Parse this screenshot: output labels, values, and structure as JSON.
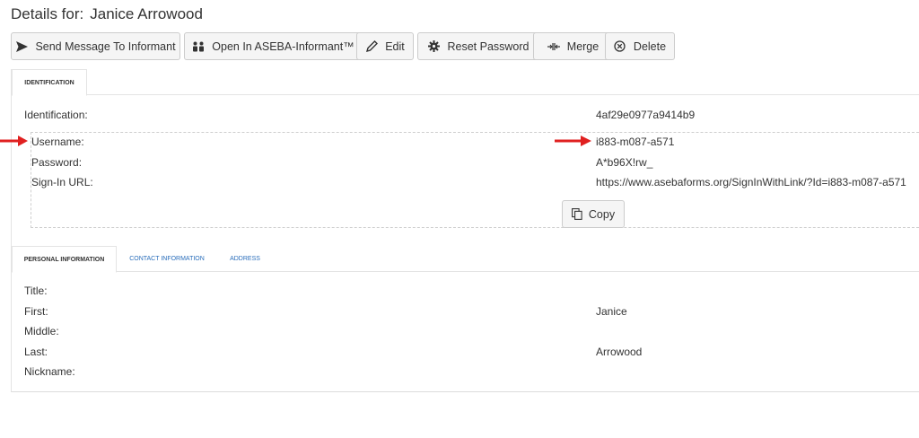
{
  "header": {
    "title_prefix": "Details for:",
    "title_name": "Janice Arrowood"
  },
  "toolbar": {
    "send_message": "Send Message To Informant",
    "open_aseba": "Open In ASEBA-Informant™",
    "edit": "Edit",
    "reset_password": "Reset Password",
    "merge": "Merge",
    "delete": "Delete"
  },
  "identification": {
    "tab_label": "IDENTIFICATION",
    "id_label": "Identification:",
    "id_value": "4af29e0977a9414b9",
    "username_label": "Username:",
    "username_value": "i883-m087-a571",
    "password_label": "Password:",
    "password_value": "A*b96X!rw_",
    "signin_label": "Sign-In URL:",
    "signin_value": "https://www.asebaforms.org/SignInWithLink/?Id=i883-m087-a571",
    "copy_label": "Copy"
  },
  "personal": {
    "tabs": [
      "PERSONAL INFORMATION",
      "CONTACT INFORMATION",
      "ADDRESS"
    ],
    "fields": [
      {
        "label": "Title:",
        "value": ""
      },
      {
        "label": "First:",
        "value": "Janice"
      },
      {
        "label": "Middle:",
        "value": ""
      },
      {
        "label": "Last:",
        "value": "Arrowood"
      },
      {
        "label": "Nickname:",
        "value": ""
      }
    ]
  },
  "colors": {
    "annotation_arrow": "#e02020",
    "link_tab": "#2a6ebb"
  },
  "icons": {
    "send": "send-icon",
    "aseba": "users-icon",
    "edit": "pencil-icon",
    "reset": "gear-icon",
    "merge": "merge-icon",
    "delete": "circle-x-icon",
    "copy": "copy-icon"
  }
}
